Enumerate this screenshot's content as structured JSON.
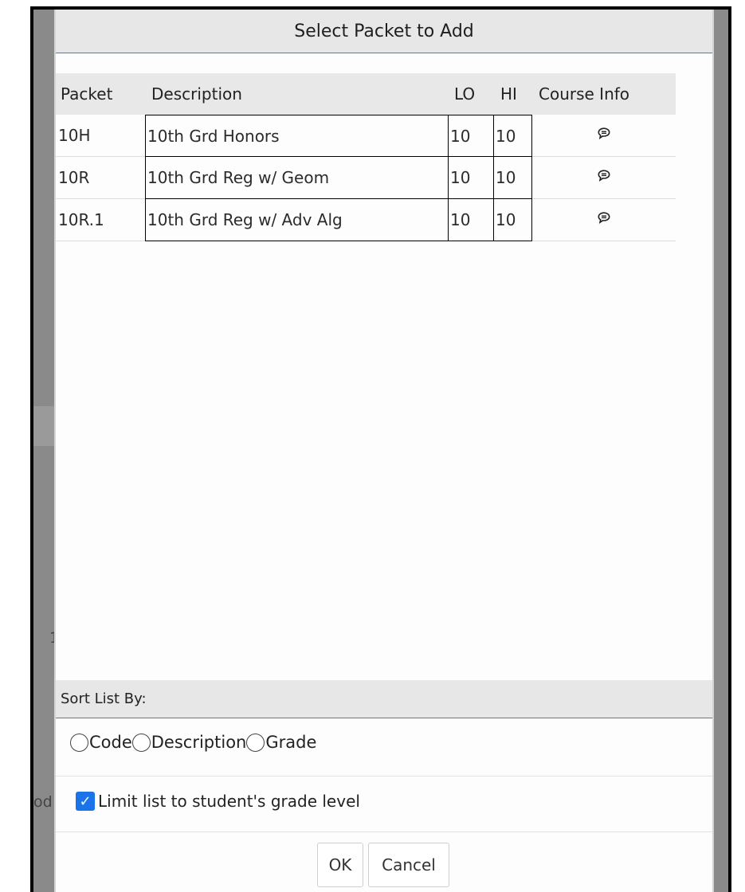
{
  "dialog": {
    "title": "Select Packet to Add"
  },
  "table": {
    "headers": {
      "packet": "Packet",
      "description": "Description",
      "lo": "LO",
      "hi": "HI",
      "course_info": "Course Info"
    },
    "rows": [
      {
        "packet": "10H",
        "description": "10th Grd Honors",
        "lo": "10",
        "hi": "10",
        "info_icon": "speech-bubble-icon"
      },
      {
        "packet": "10R",
        "description": "10th Grd Reg w/ Geom",
        "lo": "10",
        "hi": "10",
        "info_icon": "speech-bubble-icon"
      },
      {
        "packet": "10R.1",
        "description": "10th Grd Reg w/ Adv Alg",
        "lo": "10",
        "hi": "10",
        "info_icon": "speech-bubble-icon"
      }
    ]
  },
  "sort": {
    "label": "Sort List By:",
    "options": [
      "Code",
      "Description",
      "Grade"
    ],
    "selected": null
  },
  "limit": {
    "label": "Limit list to student's grade level",
    "checked": true
  },
  "buttons": {
    "ok": "OK",
    "cancel": "Cancel"
  },
  "background": {
    "fragment_1": "1",
    "fragment_2": "od"
  },
  "colors": {
    "accent": "#1a73e8",
    "header_bg": "#e7e7e7",
    "overlay": "#8a8a8a"
  }
}
